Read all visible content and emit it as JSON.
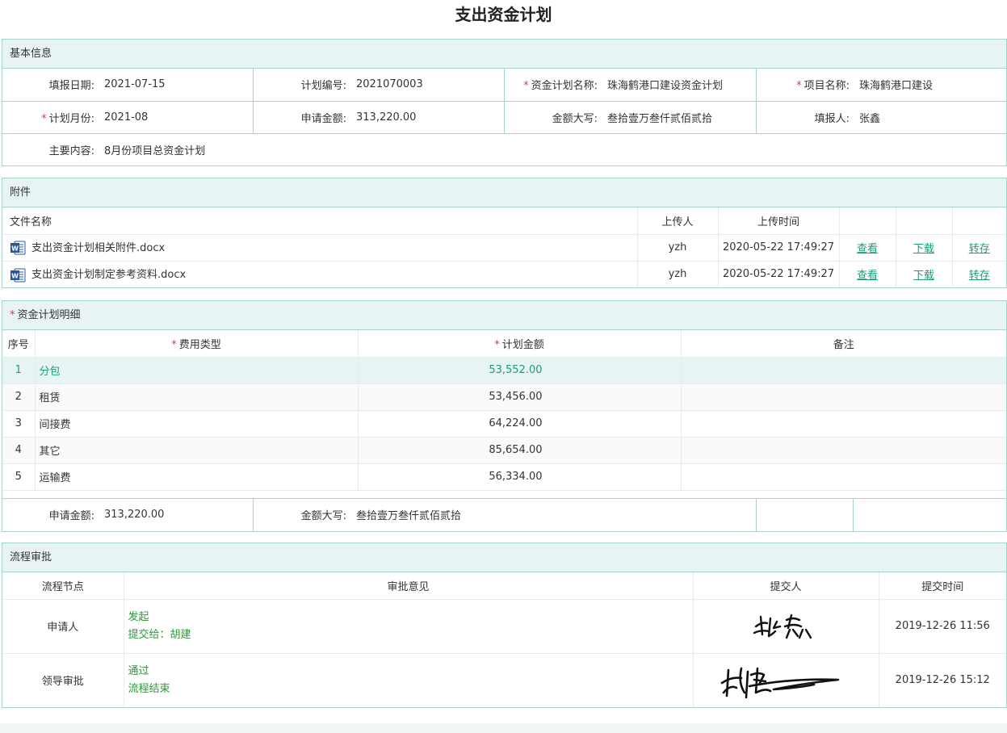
{
  "page_title": "支出资金计划",
  "basic": {
    "heading": "基本信息",
    "fill_date_label": "填报日期:",
    "fill_date": "2021-07-15",
    "plan_no_label": "计划编号:",
    "plan_no": "2021070003",
    "plan_name_label": "资金计划名称:",
    "plan_name": "珠海鹤港口建设资金计划",
    "project_label": "项目名称:",
    "project": "珠海鹤港口建设",
    "month_label": "计划月份:",
    "month": "2021-08",
    "amount_label": "申请金额:",
    "amount": "313,220.00",
    "amount_cn_label": "金额大写:",
    "amount_cn": "叁拾壹万叁仟贰佰贰拾",
    "filler_label": "填报人:",
    "filler": "张鑫",
    "content_label": "主要内容:",
    "content": "8月份项目总资金计划"
  },
  "attachments": {
    "heading": "附件",
    "col_name": "文件名称",
    "col_uploader": "上传人",
    "col_time": "上传时间",
    "view": "查看",
    "download": "下载",
    "transfer": "转存",
    "files": [
      {
        "name": "支出资金计划相关附件.docx",
        "uploader": "yzh",
        "time": "2020-05-22 17:49:27"
      },
      {
        "name": "支出资金计划制定参考资料.docx",
        "uploader": "yzh",
        "time": "2020-05-22 17:49:27"
      }
    ]
  },
  "detail": {
    "heading": "资金计划明细",
    "col_no": "序号",
    "col_type": "费用类型",
    "col_amount": "计划金额",
    "col_note": "备注",
    "rows": [
      {
        "no": "1",
        "type": "分包",
        "amount": "53,552.00"
      },
      {
        "no": "2",
        "type": "租赁",
        "amount": "53,456.00"
      },
      {
        "no": "3",
        "type": "间接费",
        "amount": "64,224.00"
      },
      {
        "no": "4",
        "type": "其它",
        "amount": "85,654.00"
      },
      {
        "no": "5",
        "type": "运输费",
        "amount": "56,334.00"
      }
    ],
    "sum_amount_label": "申请金额:",
    "sum_amount": "313,220.00",
    "sum_cn_label": "金额大写:",
    "sum_cn": "叁拾壹万叁仟贰佰贰拾"
  },
  "flow": {
    "heading": "流程审批",
    "col_node": "流程节点",
    "col_opinion": "审批意见",
    "col_submitter": "提交人",
    "col_time": "提交时间",
    "rows": [
      {
        "node": "申请人",
        "line1": "发起",
        "line2": "提交给：胡建",
        "time": "2019-12-26 11:56"
      },
      {
        "node": "领导审批",
        "line1": "通过",
        "line2": "流程结束",
        "time": "2019-12-26 15:12"
      }
    ]
  },
  "colors": {
    "accent": "#1a9e77",
    "header_bg": "#e8f4f3",
    "border": "#a9d3cf",
    "required": "#e23b3b"
  }
}
